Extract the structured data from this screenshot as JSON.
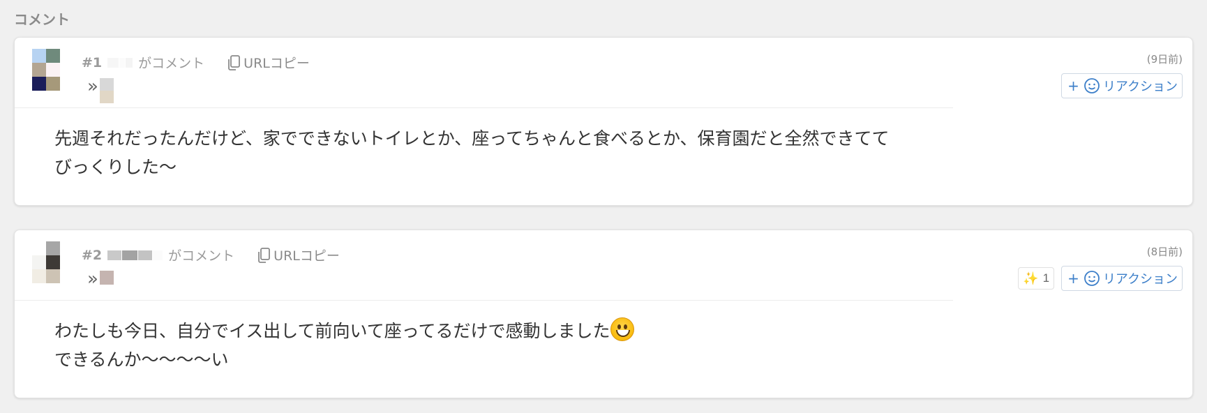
{
  "section": {
    "title": "コメント"
  },
  "comments": [
    {
      "number": "#1",
      "action": "がコメント",
      "url_copy": "URLコピー",
      "timestamp": "(9日前)",
      "reaction_label": "リアクション",
      "body": "先週それだったんだけど、家でできないトイレとか、座ってちゃんと食べるとか、保育園だと全然できてて\nびっくりした〜"
    },
    {
      "number": "#2",
      "action": "がコメント",
      "url_copy": "URLコピー",
      "timestamp": "(8日前)",
      "reaction_label": "リアクション",
      "sparkle_count": "1",
      "body_line1": "わたしも今日、自分でイス出して前向いて座ってるだけで感動しました",
      "body_line2": "できるんか〜〜〜〜い"
    }
  ],
  "icons": {
    "copy": "copy-icon",
    "reply": "reply-arrow-icon",
    "smile": "smile-icon",
    "sparkle": "sparkles-icon",
    "emoji": "grinning-face-icon"
  },
  "colors": {
    "background": "#f0f0f0",
    "card": "#ffffff",
    "accent": "#3d7fc9",
    "muted_text": "#9a9a9a"
  }
}
